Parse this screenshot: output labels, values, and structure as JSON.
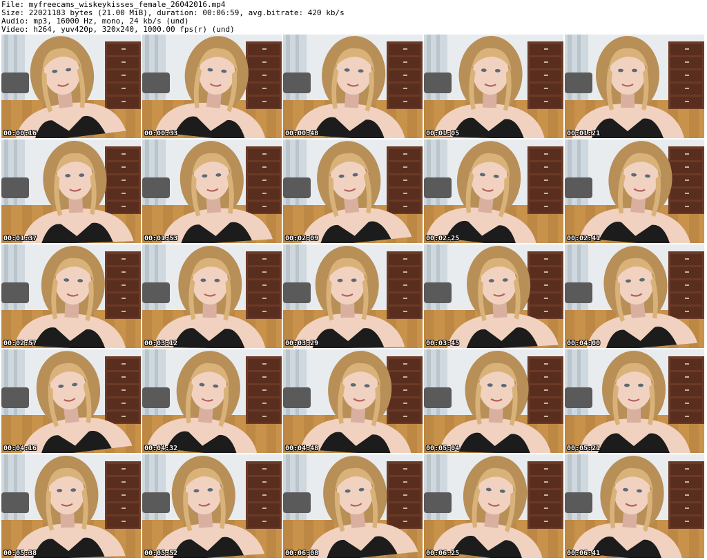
{
  "header": {
    "line1": "File: myfreecams_wiskeykisses_female_26042016.mp4",
    "line2": "Size: 22021183 bytes (21.00 MiB), duration: 00:06:59, avg.bitrate: 420 kb/s",
    "line3": "Audio: mp3, 16000 Hz, mono, 24 kb/s (und)",
    "line4": "Video: h264, yuv420p, 320x240, 1000.00 fps(r) (und)"
  },
  "thumbnails": [
    {
      "timestamp": "00:00:16"
    },
    {
      "timestamp": "00:00:33"
    },
    {
      "timestamp": "00:00:48"
    },
    {
      "timestamp": "00:01:05"
    },
    {
      "timestamp": "00:01:21"
    },
    {
      "timestamp": "00:01:37"
    },
    {
      "timestamp": "00:01:53"
    },
    {
      "timestamp": "00:02:09"
    },
    {
      "timestamp": "00:02:25"
    },
    {
      "timestamp": "00:02:41"
    },
    {
      "timestamp": "00:02:57"
    },
    {
      "timestamp": "00:03:12"
    },
    {
      "timestamp": "00:03:29"
    },
    {
      "timestamp": "00:03:45"
    },
    {
      "timestamp": "00:04:00"
    },
    {
      "timestamp": "00:04:16"
    },
    {
      "timestamp": "00:04:32"
    },
    {
      "timestamp": "00:04:48"
    },
    {
      "timestamp": "00:05:04"
    },
    {
      "timestamp": "00:05:21"
    },
    {
      "timestamp": "00:05:38"
    },
    {
      "timestamp": "00:05:52"
    },
    {
      "timestamp": "00:06:08"
    },
    {
      "timestamp": "00:06:25"
    },
    {
      "timestamp": "00:06:41"
    }
  ],
  "colors": {
    "wall": "#e8ecef",
    "floor": "#c8924a",
    "floor_dark": "#a8743a",
    "dresser": "#6b3a26",
    "dresser_dark": "#4a2418",
    "hair": "#d9b27a",
    "hair_dark": "#b88f57",
    "skin": "#f1d2c0",
    "skin_shadow": "#d9b0a0",
    "top": "#1c1c1c",
    "chair": "#5a5a5a"
  }
}
